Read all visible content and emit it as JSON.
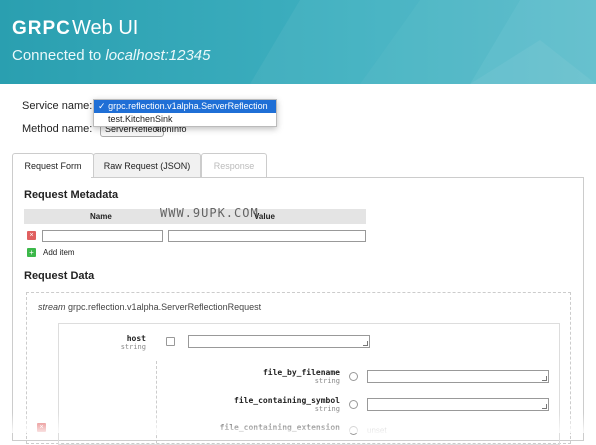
{
  "header": {
    "logo": "GRPC",
    "app_title": "Web UI",
    "connected_prefix": "Connected to",
    "connected_host": "localhost:12345"
  },
  "service": {
    "label": "Service name:",
    "options": [
      "grpc.reflection.v1alpha.ServerReflection",
      "test.KitchenSink"
    ],
    "selected_index": 0,
    "selected_checkmark": "✓"
  },
  "method": {
    "label": "Method name:",
    "value": "ServerReflectionInfo",
    "arrow": "⇕"
  },
  "tabs": [
    {
      "label": "Request Form",
      "state": "active"
    },
    {
      "label": "Raw Request (JSON)",
      "state": "inactive"
    },
    {
      "label": "Response",
      "state": "disabled"
    }
  ],
  "metadata": {
    "title": "Request Metadata",
    "col_name": "Name",
    "col_value": "Value",
    "add_item": "Add item",
    "delete_glyph": "×",
    "add_glyph": "+"
  },
  "request_data": {
    "title": "Request Data",
    "stream_keyword": "stream",
    "message_type": "grpc.reflection.v1alpha.ServerReflectionRequest",
    "fields": [
      {
        "name": "host",
        "type": "string"
      },
      {
        "name": "file_by_filename",
        "type": "string"
      },
      {
        "name": "file_containing_symbol",
        "type": "string"
      },
      {
        "name": "file_containing_extension",
        "type": ""
      }
    ],
    "unset_text": "unset"
  },
  "watermark": "WWW.9UPK.COM",
  "colors": {
    "header_bg": "#2a9fb0",
    "selected_option": "#1f6fd6",
    "delete_button": "#e06060",
    "add_button": "#3cb84a"
  }
}
